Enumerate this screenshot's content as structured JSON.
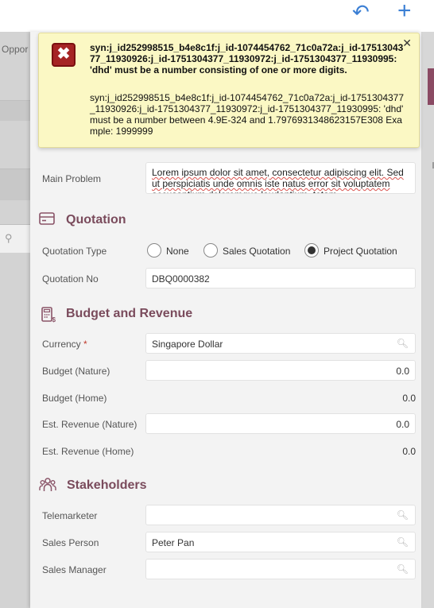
{
  "topbar": {
    "undo_icon": "undo-icon",
    "add_icon": "plus-icon"
  },
  "background": {
    "left_label": "Oppor"
  },
  "error": {
    "summary": "syn:j_id252998515_b4e8c1f:j_id-1074454762_71c0a72a:j_id-1751304377_11930926:j_id-1751304377_11930972:j_id-1751304377_11930995: 'dhd' must be a number consisting of one or more digits.",
    "detail": "syn:j_id252998515_b4e8c1f:j_id-1074454762_71c0a72a:j_id-1751304377_11930926:j_id-1751304377_11930972:j_id-1751304377_11930995: 'dhd' must be a number between 4.9E-324 and 1.7976931348623157E308 Example: 1999999"
  },
  "main_problem": {
    "label": "Main Problem",
    "value": "Lorem ipsum dolor sit amet, consectetur adipiscing elit. Sed ut perspiciatis unde omnis iste natus error sit voluptatem accusantium doloremque laudantium, totam"
  },
  "quotation": {
    "title": "Quotation",
    "type_label": "Quotation Type",
    "options": [
      "None",
      "Sales Quotation",
      "Project Quotation"
    ],
    "selected": "Project Quotation",
    "no_label": "Quotation No",
    "no_value": "DBQ0000382"
  },
  "budget": {
    "title": "Budget and Revenue",
    "currency_label": "Currency",
    "currency_required": "*",
    "currency_value": "Singapore Dollar",
    "budget_nature_label": "Budget (Nature)",
    "budget_nature_value": "0.0",
    "budget_home_label": "Budget (Home)",
    "budget_home_value": "0.0",
    "est_rev_nature_label": "Est. Revenue (Nature)",
    "est_rev_nature_value": "0.0",
    "est_rev_home_label": "Est. Revenue (Home)",
    "est_rev_home_value": "0.0"
  },
  "stakeholders": {
    "title": "Stakeholders",
    "telemarketer_label": "Telemarketer",
    "telemarketer_value": "",
    "sales_person_label": "Sales Person",
    "sales_person_value": "Peter Pan",
    "sales_manager_label": "Sales Manager",
    "sales_manager_value": ""
  },
  "colors": {
    "accent": "#3b7fd4",
    "section": "#7a4b5c",
    "toast_bg": "#fbf8c4",
    "error_icon": "#a62424"
  }
}
